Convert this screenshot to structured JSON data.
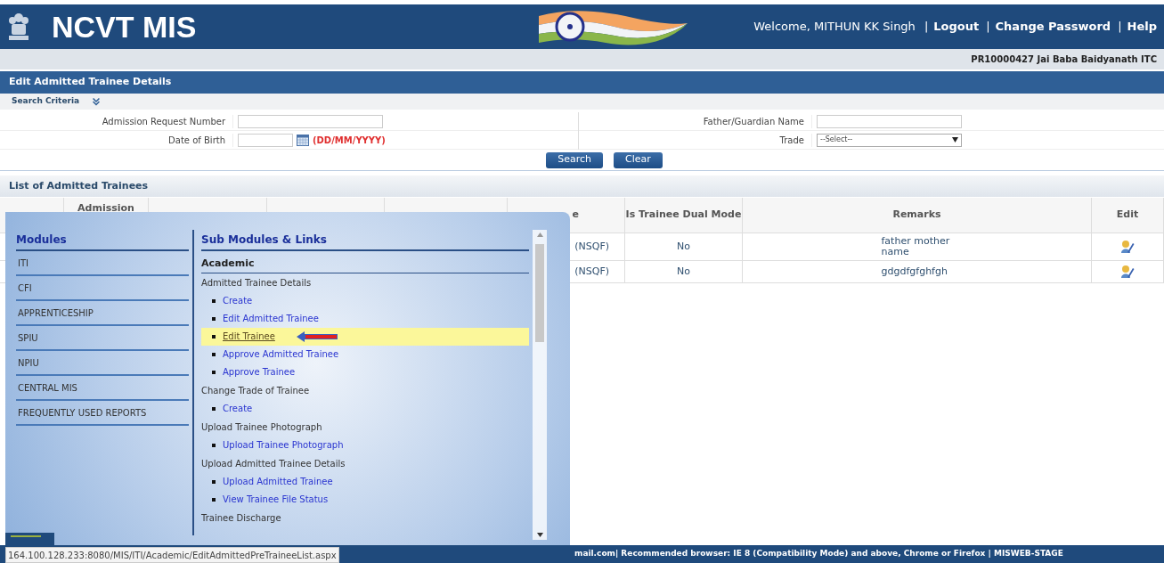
{
  "header": {
    "title": "NCVT MIS",
    "welcome": "Welcome, MITHUN KK Singh",
    "links": [
      {
        "separator": "|",
        "label": "Logout"
      },
      {
        "separator": "|",
        "label": "Change Password"
      },
      {
        "separator": "|",
        "label": "Help"
      }
    ]
  },
  "institute": "PR10000427 Jai Baba Baidyanath ITC",
  "page_title": "Edit Admitted Trainee Details",
  "search_criteria": {
    "label": "Search Criteria",
    "expanded": false
  },
  "form": {
    "left": [
      {
        "kind": "text",
        "label": "Admission Request Number"
      },
      {
        "kind": "date",
        "label": "Date of Birth",
        "hint": "(DD/MM/YYYY)"
      }
    ],
    "right": [
      {
        "kind": "text",
        "label": "Father/Guardian Name"
      },
      {
        "kind": "select",
        "label": "Trade",
        "value": "--Select--"
      }
    ]
  },
  "buttons": [
    "Search",
    "Clear"
  ],
  "list_title": "List of Admitted Trainees",
  "table": {
    "columns": [
      "Admission",
      "e",
      "Is Trainee Dual Mode",
      "Remarks",
      "Edit"
    ],
    "rows": [
      {
        "column_5": "(NSQF)",
        "dual_mode": "No",
        "remarks": "father mother name"
      },
      {
        "column_5": "(NSQF)",
        "dual_mode": "No",
        "remarks": "gdgdfgfghfgh"
      }
    ]
  },
  "menu": {
    "modules_title": "Modules",
    "modules": [
      "ITI",
      "CFI",
      "APPRENTICESHIP",
      "SPIU",
      "NPIU",
      "CENTRAL MIS",
      "FREQUENTLY USED REPORTS"
    ],
    "sub_title": "Sub Modules & Links",
    "section": "Academic",
    "groups": [
      {
        "title": "Admitted Trainee Details",
        "links": [
          {
            "label": "Create",
            "selected": false
          },
          {
            "label": "Edit Admitted Trainee",
            "selected": false
          },
          {
            "label": "Edit Trainee",
            "selected": true
          },
          {
            "label": "Approve Admitted Trainee",
            "selected": false
          },
          {
            "label": "Approve Trainee",
            "selected": false
          }
        ]
      },
      {
        "title": "Change Trade of Trainee",
        "links": [
          {
            "label": "Create",
            "selected": false
          }
        ]
      },
      {
        "title": "Upload Trainee Photograph",
        "links": [
          {
            "label": "Upload Trainee Photograph",
            "selected": false
          }
        ]
      },
      {
        "title": "Upload Admitted Trainee Details",
        "links": [
          {
            "label": "Upload Admitted Trainee",
            "selected": false
          },
          {
            "label": "View Trainee File Status",
            "selected": false
          }
        ]
      },
      {
        "title": "Trainee Discharge"
      }
    ]
  },
  "status_url": "164.100.128.233:8080/MIS/ITI/Academic/EditAdmittedPreTraineeList.aspx",
  "footer": "mail.com| Recommended browser: IE 8 (Compatibility Mode) and above, Chrome or Firefox | MISWEB-STAGE"
}
